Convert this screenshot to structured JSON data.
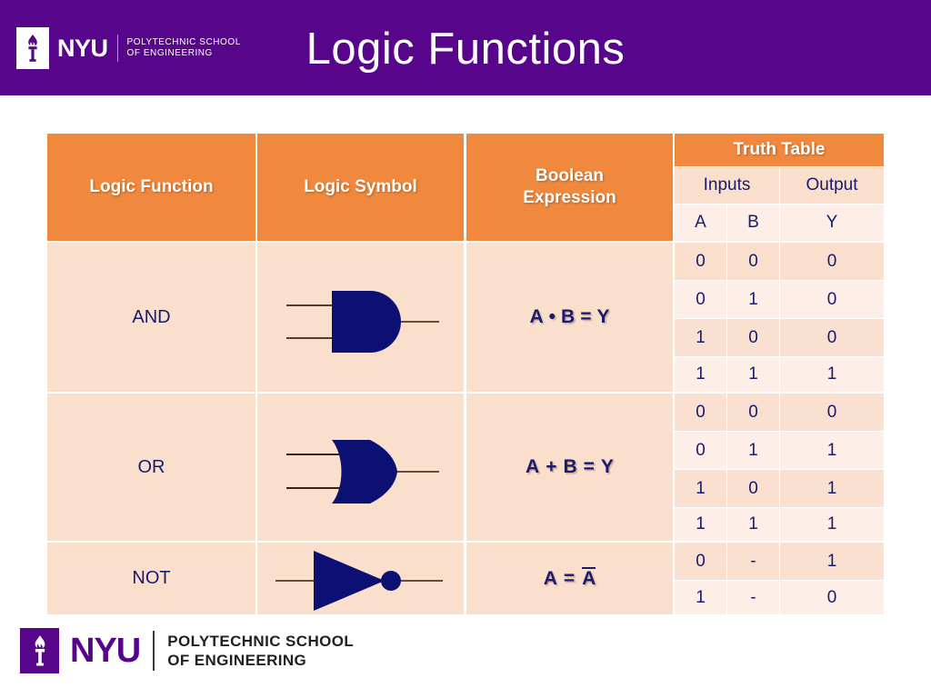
{
  "header": {
    "title": "Logic Functions",
    "logo": {
      "wordmark": "NYU",
      "line1": "POLYTECHNIC SCHOOL",
      "line2": "OF ENGINEERING",
      "torch_icon": "torch-icon"
    },
    "bg_color": "#57068C"
  },
  "footer": {
    "logo": {
      "wordmark": "NYU",
      "line1": "POLYTECHNIC SCHOOL",
      "line2": "OF ENGINEERING",
      "torch_icon": "torch-icon"
    }
  },
  "table": {
    "headers": {
      "logic_function": "Logic Function",
      "logic_symbol": "Logic Symbol",
      "boolean_expression": "Boolean Expression",
      "boolean_expression_line1": "Boolean",
      "boolean_expression_line2": "Expression",
      "truth_table": "Truth Table",
      "inputs": "Inputs",
      "output": "Output",
      "col_a": "A",
      "col_b": "B",
      "col_y": "Y"
    },
    "header_color": "#F0883E",
    "text_color": "#1A1A6E",
    "rows": [
      {
        "function": "AND",
        "symbol_icon": "and-gate-icon",
        "expression": "A • B = Y",
        "expr_left": "A",
        "expr_op": "•",
        "expr_right": "B",
        "expr_eq": "=",
        "expr_out": "Y",
        "truth": [
          {
            "a": "0",
            "b": "0",
            "y": "0"
          },
          {
            "a": "0",
            "b": "1",
            "y": "0"
          },
          {
            "a": "1",
            "b": "0",
            "y": "0"
          },
          {
            "a": "1",
            "b": "1",
            "y": "1"
          }
        ]
      },
      {
        "function": "OR",
        "symbol_icon": "or-gate-icon",
        "expression": "A + B = Y",
        "expr_left": "A",
        "expr_op": "+",
        "expr_right": "B",
        "expr_eq": "=",
        "expr_out": "Y",
        "truth": [
          {
            "a": "0",
            "b": "0",
            "y": "0"
          },
          {
            "a": "0",
            "b": "1",
            "y": "1"
          },
          {
            "a": "1",
            "b": "0",
            "y": "1"
          },
          {
            "a": "1",
            "b": "1",
            "y": "1"
          }
        ]
      },
      {
        "function": "NOT",
        "symbol_icon": "not-gate-icon",
        "expression": "A = Ā",
        "expr_left": "A",
        "expr_eq": "=",
        "expr_out": "A",
        "truth": [
          {
            "a": "0",
            "b": "-",
            "y": "1"
          },
          {
            "a": "1",
            "b": "-",
            "y": "0"
          }
        ]
      }
    ]
  }
}
